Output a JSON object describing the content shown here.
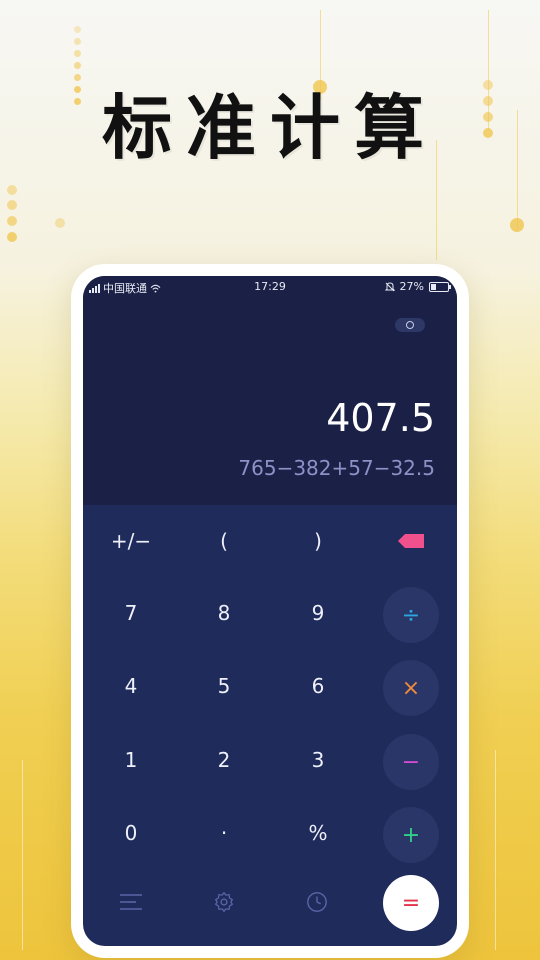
{
  "headline": "标准计算",
  "status": {
    "carrier": "中国联通",
    "time": "17:29",
    "battery": "27%"
  },
  "display": {
    "result": "407.5",
    "expression": "765−382+57−32.5"
  },
  "keys": {
    "row1": [
      "+/−",
      "(",
      ")"
    ],
    "row2": [
      "7",
      "8",
      "9"
    ],
    "row3": [
      "4",
      "5",
      "6"
    ],
    "row4": [
      "1",
      "2",
      "3"
    ],
    "row5": [
      "0",
      "·",
      "%"
    ],
    "divide": "÷",
    "multiply": "×",
    "minus": "−",
    "plus": "+",
    "equals": "="
  },
  "colors": {
    "divide": "#2aa7e0",
    "multiply": "#f08a3c",
    "minus": "#d64ad6",
    "plus": "#2fd08a",
    "equals": "#e2334a",
    "backspace": "#f0508c"
  },
  "icons": {
    "backspace": "backspace-icon",
    "menu": "menu-icon",
    "settings": "gear-icon",
    "history": "clock-icon",
    "toggle": "mode-toggle-icon"
  }
}
